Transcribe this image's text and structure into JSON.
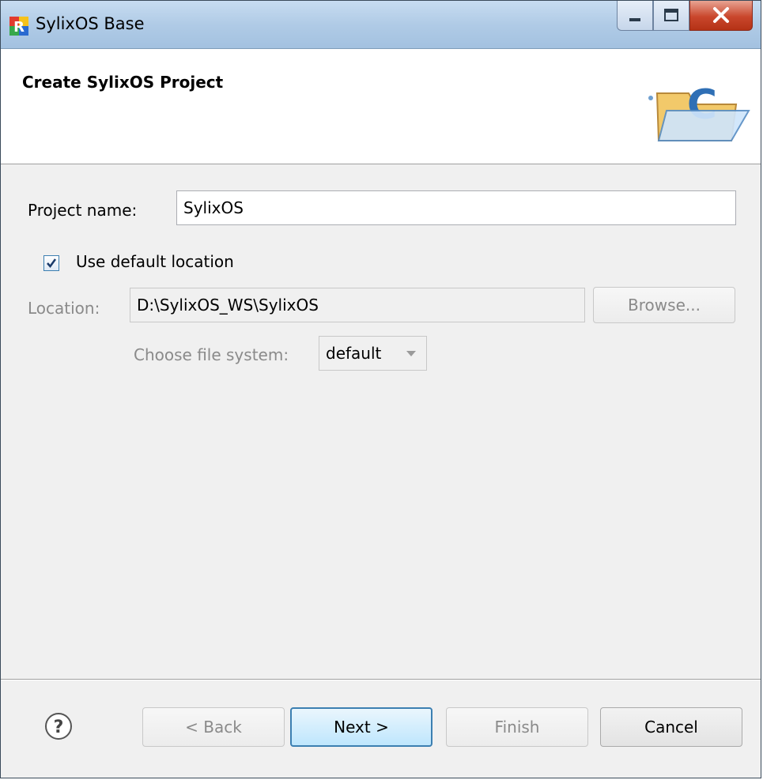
{
  "window": {
    "title": "SylixOS Base",
    "minimize_icon": "minimize-icon",
    "maximize_icon": "maximize-icon",
    "close_icon": "close-x-icon"
  },
  "header": {
    "title": "Create SylixOS Project",
    "icon": "new-c-project-folder-icon"
  },
  "form": {
    "project_name_label": "Project name:",
    "project_name_value": "SylixOS",
    "use_default_label": "Use default location",
    "use_default_checked": true,
    "location_label": "Location:",
    "location_value": "D:\\SylixOS_WS\\SylixOS",
    "browse_label": "Browse...",
    "filesystem_label": "Choose file system:",
    "filesystem_value": "default"
  },
  "footer": {
    "help_icon": "help-question-icon",
    "back_label": "< Back",
    "next_label": "Next >",
    "finish_label": "Finish",
    "cancel_label": "Cancel"
  },
  "colors": {
    "accent": "#3c7fb1",
    "close_button": "#c9462c"
  }
}
